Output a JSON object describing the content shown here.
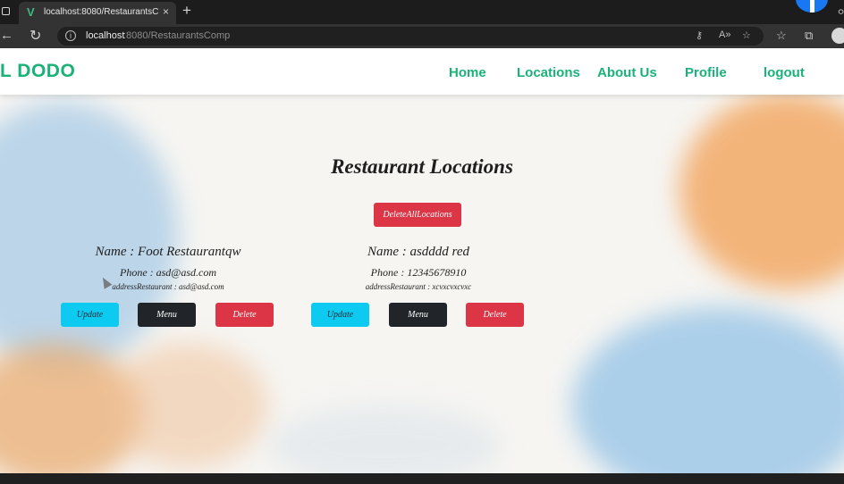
{
  "browser": {
    "tab_title": "localhost:8080/RestaurantsComp",
    "tab_favicon": "V",
    "tab_close": "×",
    "new_tab": "+",
    "url_host": "localhost",
    "url_path": ":8080/RestaurantsComp",
    "back_icon": "←",
    "reload_icon": "↻"
  },
  "navbar": {
    "brand": "L DODO",
    "links": [
      "Home",
      "Locations",
      "About Us",
      "Profile",
      "logout"
    ]
  },
  "main": {
    "title": "Restaurant Locations",
    "delete_all_label": "DeleteAllLocations"
  },
  "restaurants": [
    {
      "name": "Name : Foot Restaurantqw",
      "phone": "Phone : asd@asd.com",
      "address": "addressRestaurant : asd@asd.com",
      "update_label": "Update",
      "menu_label": "Menu",
      "delete_label": "Delete"
    },
    {
      "name": "Name : asdddd red",
      "phone": "Phone : 12345678910",
      "address": "addressRestaurant : xcvxcvxcvxc",
      "update_label": "Update",
      "menu_label": "Menu",
      "delete_label": "Delete"
    }
  ],
  "colors": {
    "brand_green": "#1ab278",
    "danger": "#dc3545",
    "info": "#0dcaf0",
    "dark": "#212529"
  }
}
